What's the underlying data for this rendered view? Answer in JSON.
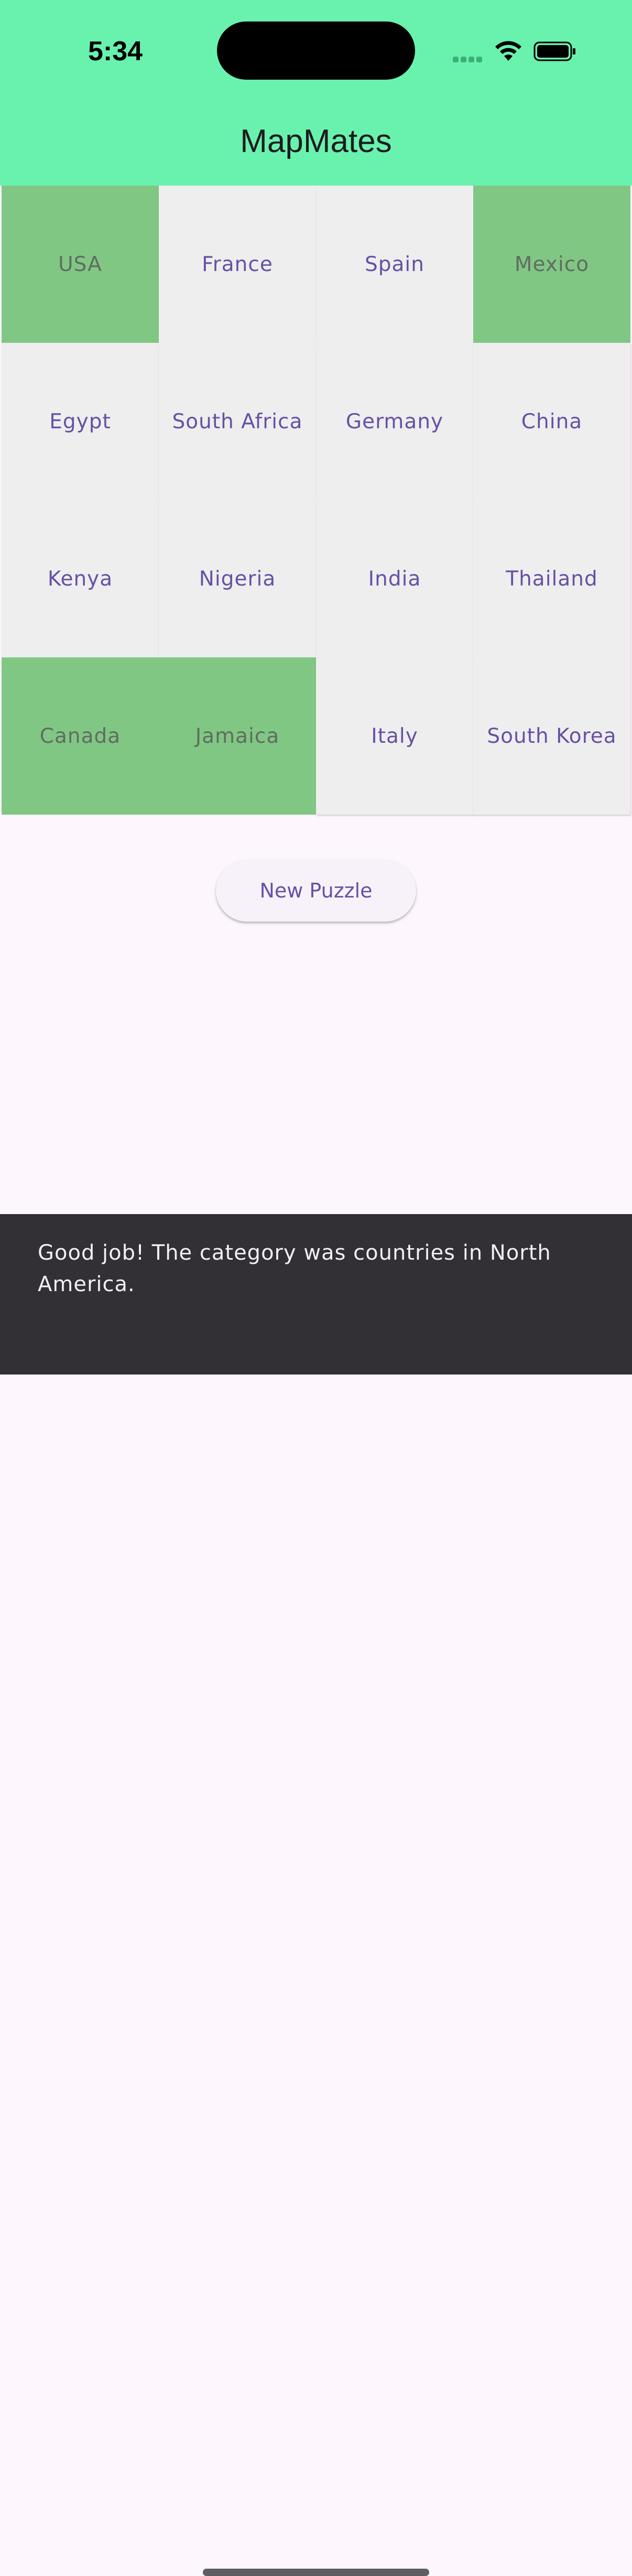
{
  "status_bar": {
    "time": "5:34",
    "icons": [
      "cellular-signal-icon",
      "wifi-icon",
      "battery-icon"
    ]
  },
  "app_bar": {
    "title": "MapMates",
    "background_color": "#69f2ae"
  },
  "grid": {
    "rows": [
      [
        {
          "label": "USA",
          "state": "solved"
        },
        {
          "label": "France",
          "state": "unsolved"
        },
        {
          "label": "Spain",
          "state": "unsolved"
        },
        {
          "label": "Mexico",
          "state": "solved"
        }
      ],
      [
        {
          "label": "Egypt",
          "state": "unsolved"
        },
        {
          "label": "South Africa",
          "state": "unsolved"
        },
        {
          "label": "Germany",
          "state": "unsolved"
        },
        {
          "label": "China",
          "state": "unsolved"
        }
      ],
      [
        {
          "label": "Kenya",
          "state": "unsolved"
        },
        {
          "label": "Nigeria",
          "state": "unsolved"
        },
        {
          "label": "India",
          "state": "unsolved"
        },
        {
          "label": "Thailand",
          "state": "unsolved"
        }
      ],
      [
        {
          "label": "Canada",
          "state": "solved"
        },
        {
          "label": "Jamaica",
          "state": "solved"
        },
        {
          "label": "Italy",
          "state": "unsolved"
        },
        {
          "label": "South Korea",
          "state": "unsolved"
        }
      ]
    ],
    "solved_color": "#81c784",
    "unsolved_color": "#eeeeee",
    "unsolved_text_color": "#6750a4"
  },
  "actions": {
    "new_puzzle_label": "New Puzzle"
  },
  "snackbar": {
    "message": "Good job! The category was countries in North America."
  }
}
